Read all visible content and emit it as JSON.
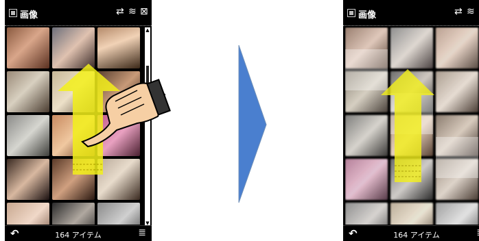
{
  "screen_left": {
    "title": "画像",
    "item_count": "164 アイテム"
  },
  "screen_right": {
    "title": "画像",
    "item_count": "164 アイテム"
  },
  "icons": {
    "app": "gallery-icon",
    "status": [
      "rotate-icon",
      "wifi-icon",
      "close-icon"
    ],
    "back": "back-arrow-icon",
    "menu": "menu-lines-icon",
    "gesture": "hand-pointer-icon",
    "direction": "up-arrow-icon",
    "transition": "right-triangle-icon"
  },
  "colors": {
    "arrow": "#f3f01a",
    "transition": "#4a7fcf",
    "phone_bg": "#000000"
  },
  "scroll_position": 0.1
}
